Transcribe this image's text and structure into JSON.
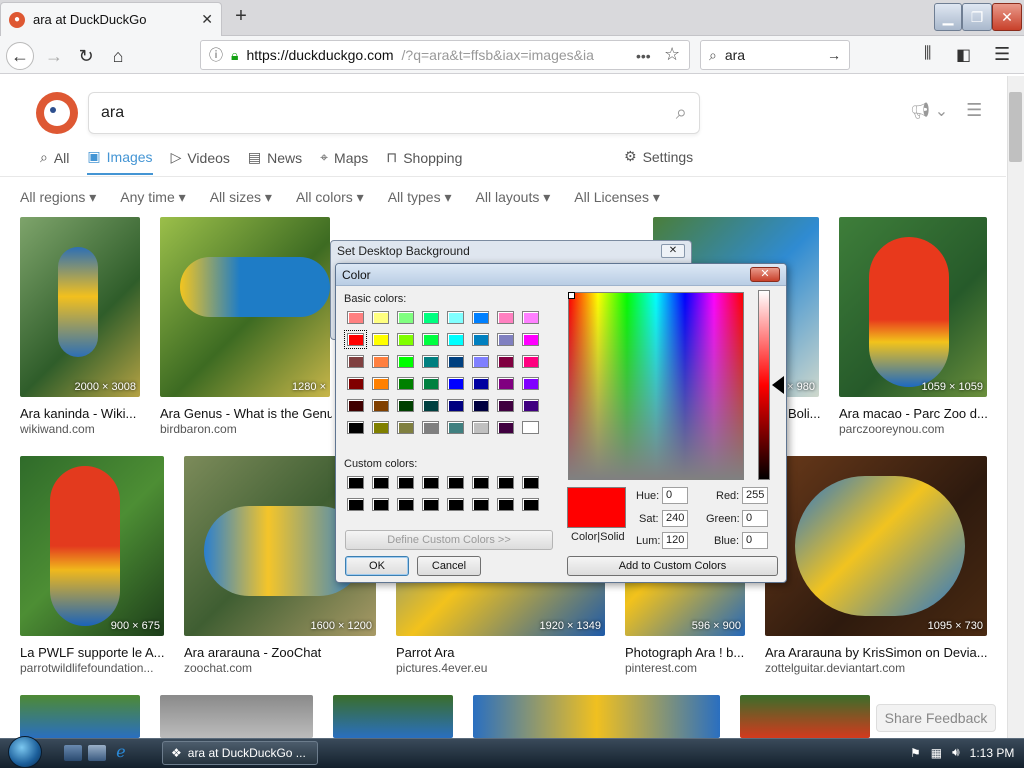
{
  "browser": {
    "tab_title": "ara at DuckDuckGo",
    "url_host": "https://duckduckgo.com",
    "url_rest": "/?q=ara&t=ffsb&iax=images&ia",
    "search_value": "ara"
  },
  "ddg": {
    "query": "ara",
    "tabs": [
      {
        "label": "All",
        "icon": "search-icon"
      },
      {
        "label": "Images",
        "icon": "image-icon",
        "active": true
      },
      {
        "label": "Videos",
        "icon": "video-icon"
      },
      {
        "label": "News",
        "icon": "news-icon"
      },
      {
        "label": "Maps",
        "icon": "map-pin-icon"
      },
      {
        "label": "Shopping",
        "icon": "shopping-bag-icon"
      }
    ],
    "settings_label": "Settings",
    "filters": [
      "All regions",
      "Any time",
      "All sizes",
      "All colors",
      "All types",
      "All layouts",
      "All Licenses"
    ],
    "results_row1": [
      {
        "size": "2000 × 3008",
        "title": "Ara kaninda - Wiki...",
        "source": "wikiwand.com"
      },
      {
        "size": "1280 ×",
        "title": "Ara Genus - What is the Genus",
        "source": "birdbaron.com"
      },
      {
        "size": "× 980",
        "title": "Boli...",
        "source": ""
      },
      {
        "size": "1059 × 1059",
        "title": "Ara macao - Parc Zoo d...",
        "source": "parczooreynou.com"
      }
    ],
    "results_row2": [
      {
        "size": "900 × 675",
        "title": "La PWLF supporte le A...",
        "source": "parrotwildlifefoundation..."
      },
      {
        "size": "1600 × 1200",
        "title": "Ara ararauna - ZooChat",
        "source": "zoochat.com"
      },
      {
        "size": "1920 × 1349",
        "title": "Parrot Ara",
        "source": "pictures.4ever.eu"
      },
      {
        "size": "596 × 900",
        "title": "Photograph Ara ! b...",
        "source": "pinterest.com"
      },
      {
        "size": "1095 × 730",
        "title": "Ara Ararauna by KrisSimon on Devia...",
        "source": "zottelguitar.deviantart.com"
      }
    ],
    "feedback_label": "Share Feedback"
  },
  "bg_dialog": {
    "title": "Set Desktop Background"
  },
  "color_dialog": {
    "title": "Color",
    "basic_label": "Basic colors:",
    "custom_label": "Custom colors:",
    "basic_colors": [
      "#ff8080",
      "#ffff80",
      "#80ff80",
      "#00ff80",
      "#80ffff",
      "#0080ff",
      "#ff80c0",
      "#ff80ff",
      "#ff0000",
      "#ffff00",
      "#80ff00",
      "#00ff40",
      "#00ffff",
      "#0080c0",
      "#8080c0",
      "#ff00ff",
      "#804040",
      "#ff8040",
      "#00ff00",
      "#008080",
      "#004080",
      "#8080ff",
      "#800040",
      "#ff0080",
      "#800000",
      "#ff8000",
      "#008000",
      "#008040",
      "#0000ff",
      "#0000a0",
      "#800080",
      "#8000ff",
      "#400000",
      "#804000",
      "#004000",
      "#004040",
      "#000080",
      "#000040",
      "#400040",
      "#400080",
      "#000000",
      "#808000",
      "#808040",
      "#808080",
      "#408080",
      "#c0c0c0",
      "#400040",
      "#ffffff"
    ],
    "selected_index": 8,
    "custom_colors": [
      "#000000",
      "#000000",
      "#000000",
      "#000000",
      "#000000",
      "#000000",
      "#000000",
      "#000000",
      "#000000",
      "#000000",
      "#000000",
      "#000000",
      "#000000",
      "#000000",
      "#000000",
      "#000000"
    ],
    "define_label": "Define Custom Colors >>",
    "ok_label": "OK",
    "cancel_label": "Cancel",
    "colorsolid_label": "Color|Solid",
    "hue_label": "Hue:",
    "hue": "0",
    "sat_label": "Sat:",
    "sat": "240",
    "lum_label": "Lum:",
    "lum": "120",
    "red_label": "Red:",
    "red": "255",
    "green_label": "Green:",
    "green": "0",
    "blue_label": "Blue:",
    "blue": "0",
    "add_custom_label": "Add to Custom Colors"
  },
  "taskbar": {
    "item_label": "ara at DuckDuckGo ...",
    "clock": "1:13 PM"
  }
}
